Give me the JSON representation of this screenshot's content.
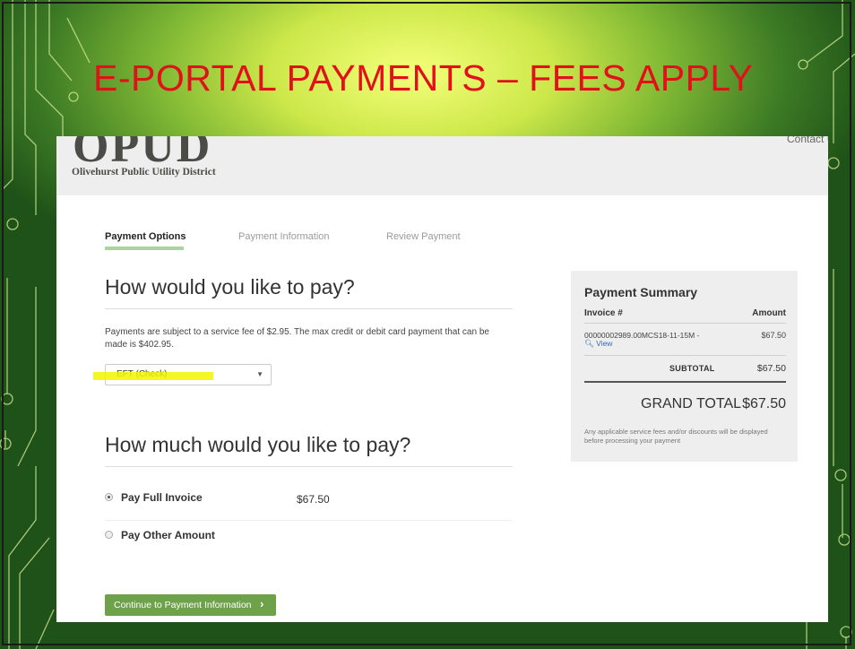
{
  "slide": {
    "title": "E-PORTAL PAYMENTS – FEES APPLY"
  },
  "header": {
    "logo_mark": "OPUD",
    "logo_name": "Olivehurst Public Utility District",
    "contact_link": "Contact U"
  },
  "steps": [
    {
      "label": "Payment Options",
      "active": true
    },
    {
      "label": "Payment Information",
      "active": false
    },
    {
      "label": "Review Payment",
      "active": false
    }
  ],
  "pay_method": {
    "heading": "How would you like to pay?",
    "fee_notice": "Payments are subject to a service fee of $2.95. The max credit or debit card payment that can be made is $402.95.",
    "select_value": "EFT (Check)",
    "highlight_color": "#f5f500"
  },
  "pay_amount": {
    "heading": "How much would you like to pay?",
    "options": [
      {
        "label": "Pay Full Invoice",
        "amount": "$67.50",
        "checked": true
      },
      {
        "label": "Pay Other Amount",
        "checked": false
      }
    ]
  },
  "continue_button": {
    "label": "Continue to Payment Information",
    "icon": "chevron-right-icon",
    "color": "#6ea24a"
  },
  "summary": {
    "title": "Payment Summary",
    "col_invoice": "Invoice #",
    "col_amount": "Amount",
    "item": {
      "invoice": "00000002989.00MCS18-11-15M -",
      "view_label": "View",
      "amount": "$67.50"
    },
    "subtotal_label": "SUBTOTAL",
    "subtotal": "$67.50",
    "grand_total_label": "GRAND TOTAL",
    "grand_total": "$67.50",
    "note": "Any applicable service fees and/or discounts will be displayed before processing your payment"
  },
  "colors": {
    "title": "#e0111b",
    "background_glow": "#f4ff7a",
    "background_dark": "#1f5218"
  }
}
